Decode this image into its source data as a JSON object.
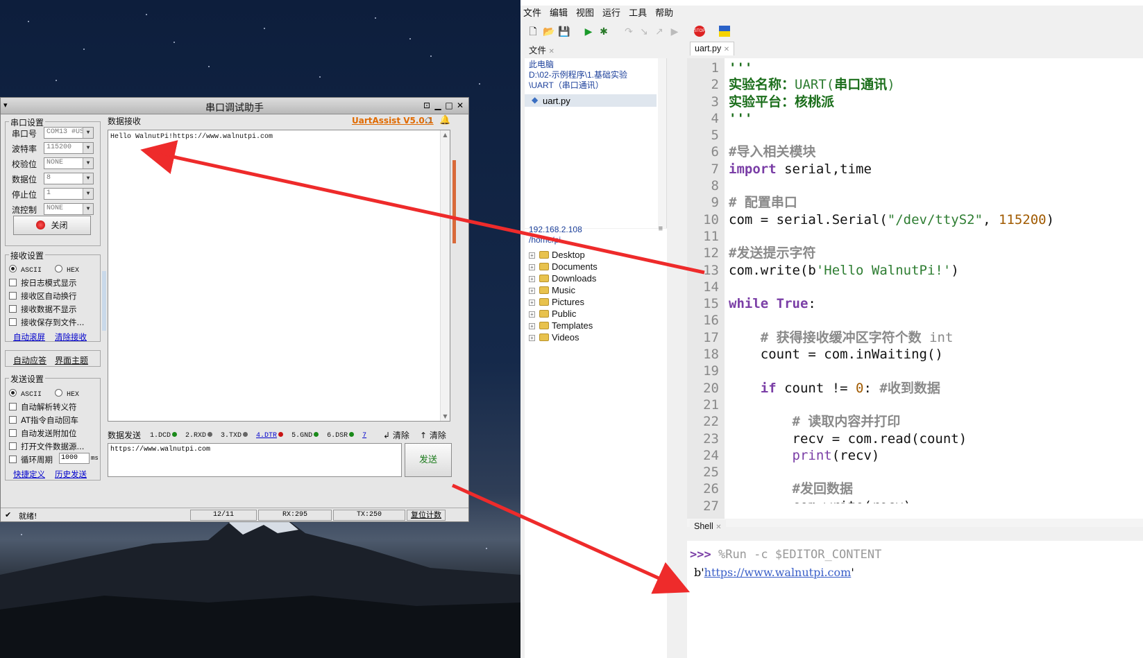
{
  "serial_window": {
    "title": "串口调试助手",
    "port_settings_title": "串口设置",
    "fields": [
      {
        "label": "串口号",
        "value": "COM13 #US"
      },
      {
        "label": "波特率",
        "value": "115200"
      },
      {
        "label": "校验位",
        "value": "NONE"
      },
      {
        "label": "数据位",
        "value": "8"
      },
      {
        "label": "停止位",
        "value": "1"
      },
      {
        "label": "流控制",
        "value": "NONE"
      }
    ],
    "close_button": "关闭",
    "receive_settings_title": "接收设置",
    "recv_ascii": "ASCII",
    "recv_hex": "HEX",
    "recv_options": [
      "按日志模式显示",
      "接收区自动换行",
      "接收数据不显示",
      "接收保存到文件..."
    ],
    "auto_scroll": "自动滚屏",
    "clear_receive": "清除接收",
    "auto_reply": "自动应答",
    "ui_theme": "界面主题",
    "send_settings_title": "发送设置",
    "send_ascii": "ASCII",
    "send_hex": "HEX",
    "send_options": [
      "自动解析转义符",
      "AT指令自动回车",
      "自动发送附加位",
      "打开文件数据源..."
    ],
    "loop_label": "循环周期",
    "loop_value": "1000",
    "loop_unit": "ms",
    "shortcut_def": "快捷定义",
    "history_send": "历史发送",
    "recv_tab": "数据接收",
    "brand": "UartAssist V5.0.1",
    "received_text": "Hello WalnutPi!https://www.walnutpi.com",
    "send_tab": "数据发送",
    "pins": [
      {
        "label": "1.DCD",
        "color": "#1a8a1a"
      },
      {
        "label": "2.RXD",
        "color": "#666666"
      },
      {
        "label": "3.TXD",
        "color": "#666666"
      },
      {
        "label": "4.DTR",
        "color": "#c81414"
      },
      {
        "label": "5.GND",
        "color": "#1a8a1a"
      },
      {
        "label": "6.DSR",
        "color": "#1a8a1a"
      },
      {
        "label": "7",
        "color": "#0000cc"
      }
    ],
    "clear1": "清除",
    "clear2": "清除",
    "send_text": "https://www.walnutpi.com",
    "send_button": "发送",
    "status_ready": "就绪!",
    "counter": "12/11",
    "rx": "RX:295",
    "tx": "TX:250",
    "reset_count": "复位计数"
  },
  "thonny": {
    "menu": [
      "文件",
      "编辑",
      "视图",
      "运行",
      "工具",
      "帮助"
    ],
    "files_tab": "文件",
    "local_label": "此电脑",
    "local_path": "D:\\02-示例程序\\1.基础实验\\UART（串口通讯）",
    "local_file": "uart.py",
    "remote_host": "192.168.2.108",
    "remote_path": "/home/pi",
    "remote_folders": [
      "Desktop",
      "Documents",
      "Downloads",
      "Music",
      "Pictures",
      "Public",
      "Templates",
      "Videos"
    ],
    "editor_tab": "uart.py",
    "line_numbers": [
      "1",
      "2",
      "3",
      "4",
      "5",
      "6",
      "7",
      "8",
      "9",
      "10",
      "11",
      "12",
      "13",
      "14",
      "15",
      "16",
      "17",
      "18",
      "19",
      "20",
      "21",
      "22",
      "23",
      "24",
      "25",
      "26",
      "27"
    ],
    "shell_tab": "Shell",
    "shell_prompt": ">>>",
    "shell_command": "%Run -c $EDITOR_CONTENT",
    "shell_output_prefix": "b'",
    "shell_output_link": "https://www.walnutpi.com",
    "shell_output_suffix": "'"
  },
  "colors": {
    "arrow": "#ee2b2b",
    "brand": "#e06a00",
    "accent": "#0000cc"
  }
}
